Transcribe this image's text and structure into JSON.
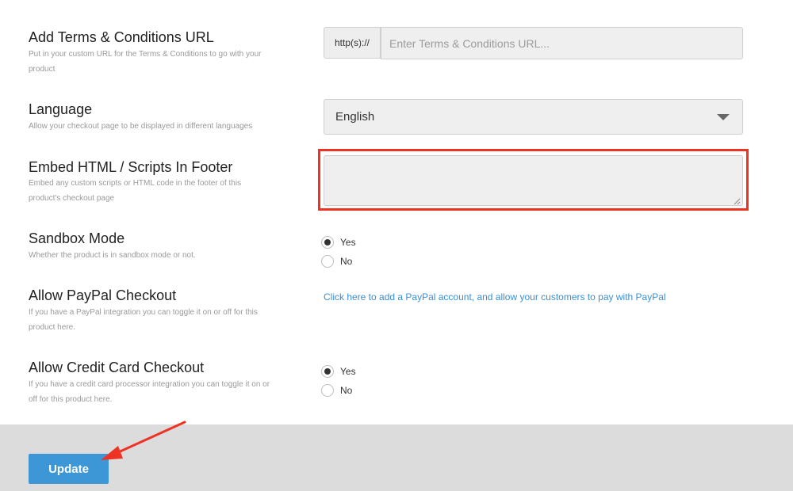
{
  "top_cropped_text": "",
  "fields": {
    "terms": {
      "label": "Add Terms & Conditions URL",
      "help": "Put in your custom URL for the Terms & Conditions to go with your product",
      "prefix": "http(s)://",
      "placeholder": "Enter Terms & Conditions URL..."
    },
    "language": {
      "label": "Language",
      "help": "Allow your checkout page to be displayed in different languages",
      "selected": "English"
    },
    "embed": {
      "label": "Embed HTML / Scripts In Footer",
      "help": "Embed any custom scripts or HTML code in the footer of this product's checkout page",
      "value": ""
    },
    "sandbox": {
      "label": "Sandbox Mode",
      "help": "Whether the product is in sandbox mode or not.",
      "yes": "Yes",
      "no": "No",
      "selected": "Yes"
    },
    "paypal": {
      "label": "Allow PayPal Checkout",
      "help": "If you have a PayPal integration you can toggle it on or off for this product here.",
      "link": "Click here to add a PayPal account, and allow your customers to pay with PayPal"
    },
    "credit_card": {
      "label": "Allow Credit Card Checkout",
      "help": "If you have a credit card processor integration you can toggle it on or off for this product here.",
      "yes": "Yes",
      "no": "No",
      "selected": "Yes"
    }
  },
  "footer": {
    "update_label": "Update"
  },
  "colors": {
    "accent": "#3d97d7",
    "highlight": "#ee3324",
    "link": "#3b8fd4",
    "footer_bg": "#dcdcdc"
  }
}
